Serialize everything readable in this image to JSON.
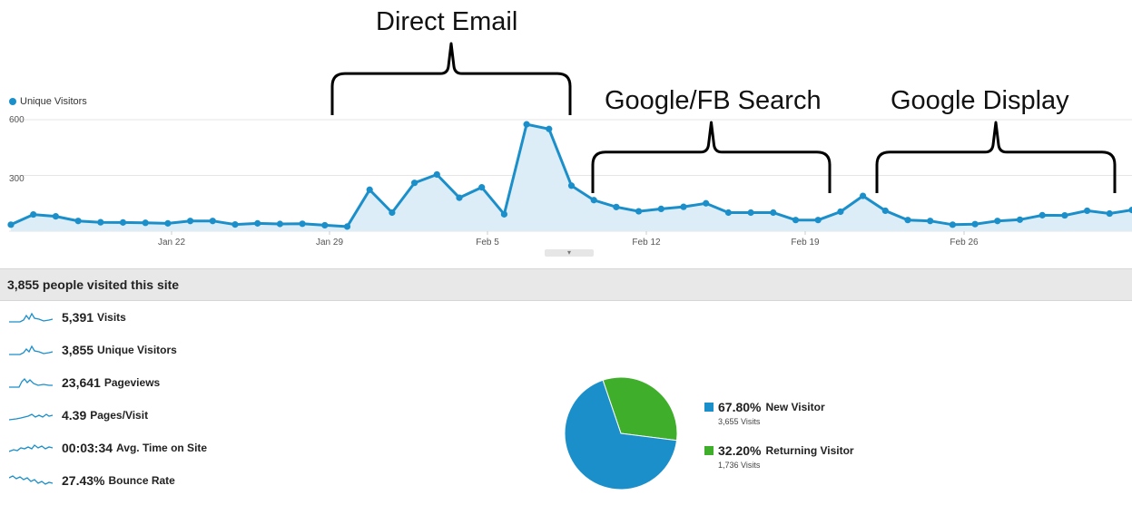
{
  "annotations": {
    "direct_email": "Direct Email",
    "google_fb_search": "Google/FB Search",
    "google_display": "Google Display"
  },
  "chart_data": {
    "type": "area",
    "series": [
      {
        "name": "Unique Visitors",
        "values": [
          35,
          90,
          80,
          55,
          48,
          47,
          45,
          42,
          55,
          55,
          36,
          42,
          39,
          40,
          32,
          25,
          223,
          100,
          260,
          305,
          180,
          236,
          91,
          575,
          550,
          245,
          167,
          130,
          107,
          120,
          131,
          150,
          100,
          100,
          100,
          60,
          60,
          105,
          190,
          110,
          60,
          55,
          35,
          38,
          55,
          62,
          86,
          85,
          110,
          95,
          114
        ]
      }
    ],
    "x_tick_labels": [
      "Jan 22",
      "Jan 29",
      "Feb 5",
      "Feb 12",
      "Feb 19",
      "Feb 26"
    ],
    "y_tick_labels": [
      "600",
      "300"
    ],
    "ylim": [
      0,
      600
    ],
    "color": "#1b8fca",
    "fill_color": "#dcedf8",
    "grid": true
  },
  "summary": {
    "headline": "3,855 people visited this site"
  },
  "metrics": [
    {
      "value": "5,391",
      "label": "Visits"
    },
    {
      "value": "3,855",
      "label": "Unique Visitors"
    },
    {
      "value": "23,641",
      "label": "Pageviews"
    },
    {
      "value": "4.39",
      "label": "Pages/Visit"
    },
    {
      "value": "00:03:34",
      "label": "Avg. Time on Site"
    },
    {
      "value": "27.43%",
      "label": "Bounce Rate"
    }
  ],
  "pie": {
    "slices": [
      {
        "label": "New Visitor",
        "percent": "67.80%",
        "fraction": 0.678,
        "visits": "3,655 Visits",
        "color": "#1b8fca"
      },
      {
        "label": "Returning Visitor",
        "percent": "32.20%",
        "fraction": 0.322,
        "visits": "1,736 Visits",
        "color": "#3fae2a"
      }
    ]
  }
}
